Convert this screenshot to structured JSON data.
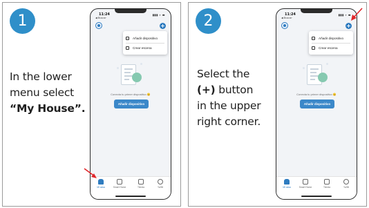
{
  "steps": [
    {
      "number": "1",
      "instruction": {
        "line1": "In the lower",
        "line2": "menu select",
        "line3": "“My House”."
      },
      "pointer_target": "my-house-tab"
    },
    {
      "number": "2",
      "instruction": {
        "line1": "Select the",
        "line2": "(+)",
        "line2_rest": " button",
        "line3": "in the upper",
        "line4": "right corner."
      },
      "pointer_target": "add-button"
    }
  ],
  "phone": {
    "status_time": "11:24",
    "status_back": "◀ Buscar",
    "status_icons": "▮▮▮ ▿ ▬",
    "add_button": "+",
    "menu": {
      "add_device": "Añadir dispositivo",
      "create_scene": "Crear escena"
    },
    "hint": "Conecta tu primer dispositivo 😊",
    "cta": "Añadir dispositivo",
    "tabs": [
      {
        "label": "Mi casa",
        "icon": "home-icon",
        "active": true
      },
      {
        "label": "Smart Home",
        "icon": "smart-home-icon",
        "active": false
      },
      {
        "label": "Tienda",
        "icon": "shopping-bag-icon",
        "active": false
      },
      {
        "label": "Yo/Mi",
        "icon": "profile-icon",
        "active": false
      }
    ]
  },
  "colors": {
    "accent": "#2f8fc9",
    "arrow": "#e0262a",
    "app_blue": "#2f7cc0",
    "illustration_green": "#86c9b0"
  }
}
